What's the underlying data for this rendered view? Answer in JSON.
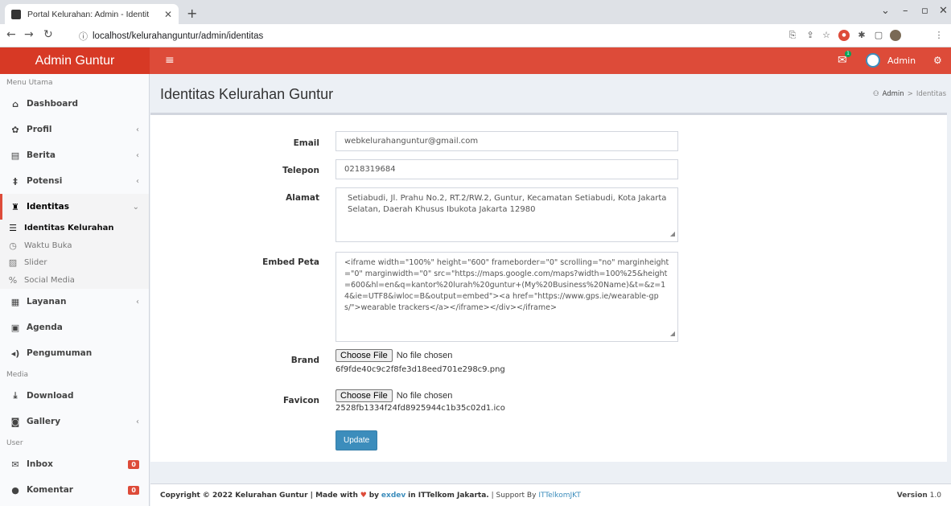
{
  "browser": {
    "tab_title": "Portal Kelurahan: Admin - Identit",
    "url": "localhost/kelurahanguntur/admin/identitas"
  },
  "header": {
    "brand": "Admin Guntur",
    "mail_badge": "1",
    "user_name": "Admin"
  },
  "sidebar": {
    "section_main": "Menu Utama",
    "section_media": "Media",
    "section_user": "User",
    "items": [
      {
        "label": "Dashboard",
        "icon": "home-icon"
      },
      {
        "label": "Profil",
        "icon": "gear-icon"
      },
      {
        "label": "Berita",
        "icon": "newspaper-icon"
      },
      {
        "label": "Potensi",
        "icon": "potensi-icon"
      },
      {
        "label": "Identitas",
        "icon": "building-icon"
      },
      {
        "label": "Layanan",
        "icon": "list-icon"
      },
      {
        "label": "Agenda",
        "icon": "calendar-icon"
      },
      {
        "label": "Pengumuman",
        "icon": "megaphone-icon"
      },
      {
        "label": "Download",
        "icon": "download-icon"
      },
      {
        "label": "Gallery",
        "icon": "camera-icon"
      },
      {
        "label": "Inbox",
        "icon": "envelope-icon",
        "badge": "0"
      },
      {
        "label": "Komentar",
        "icon": "comment-icon",
        "badge": "0"
      }
    ],
    "sub_items": [
      {
        "label": "Identitas Kelurahan",
        "icon": "list-icon"
      },
      {
        "label": "Waktu Buka",
        "icon": "clock-icon"
      },
      {
        "label": "Slider",
        "icon": "image-icon"
      },
      {
        "label": "Social Media",
        "icon": "share-icon"
      }
    ]
  },
  "page": {
    "title": "Identitas Kelurahan Guntur",
    "breadcrumb_home": "Admin",
    "breadcrumb_sep": ">",
    "breadcrumb_current": "Identitas"
  },
  "form": {
    "email_label": "Email",
    "email_value": "webkelurahanguntur@gmail.com",
    "telepon_label": "Telepon",
    "telepon_value": "0218319684",
    "alamat_label": "Alamat",
    "alamat_value": "Setiabudi, Jl. Prahu No.2, RT.2/RW.2, Guntur, Kecamatan Setiabudi, Kota Jakarta Selatan, Daerah Khusus Ibukota Jakarta 12980",
    "embed_label": "Embed Peta",
    "embed_value": "<iframe width=\"100%\" height=\"600\" frameborder=\"0\" scrolling=\"no\" marginheight=\"0\" marginwidth=\"0\" src=\"https://maps.google.com/maps?width=100%25&height=600&hl=en&q=kantor%20lurah%20guntur+(My%20Business%20Name)&t=&z=14&ie=UTF8&iwloc=B&output=embed\"><a href=\"https://www.gps.ie/wearable-gps/\">wearable trackers</a></iframe></div></iframe>",
    "brand_label": "Brand",
    "brand_file": "6f9fde40c9c2f8fe3d18eed701e298c9.png",
    "favicon_label": "Favicon",
    "favicon_file": "2528fb1334f24fd8925944c1b35c02d1.ico",
    "choose_file": "Choose File",
    "no_file": "No file chosen",
    "update_button": "Update"
  },
  "footer": {
    "copyright": "Copyright © 2022 Kelurahan Guntur | Made with",
    "by": "by",
    "exdev": "exdev",
    "in_itk": "in ITTelkom Jakarta.",
    "support": "| Support By",
    "itk_link": "ITTelkomJKT",
    "version_label": "Version",
    "version_value": "1.0"
  }
}
